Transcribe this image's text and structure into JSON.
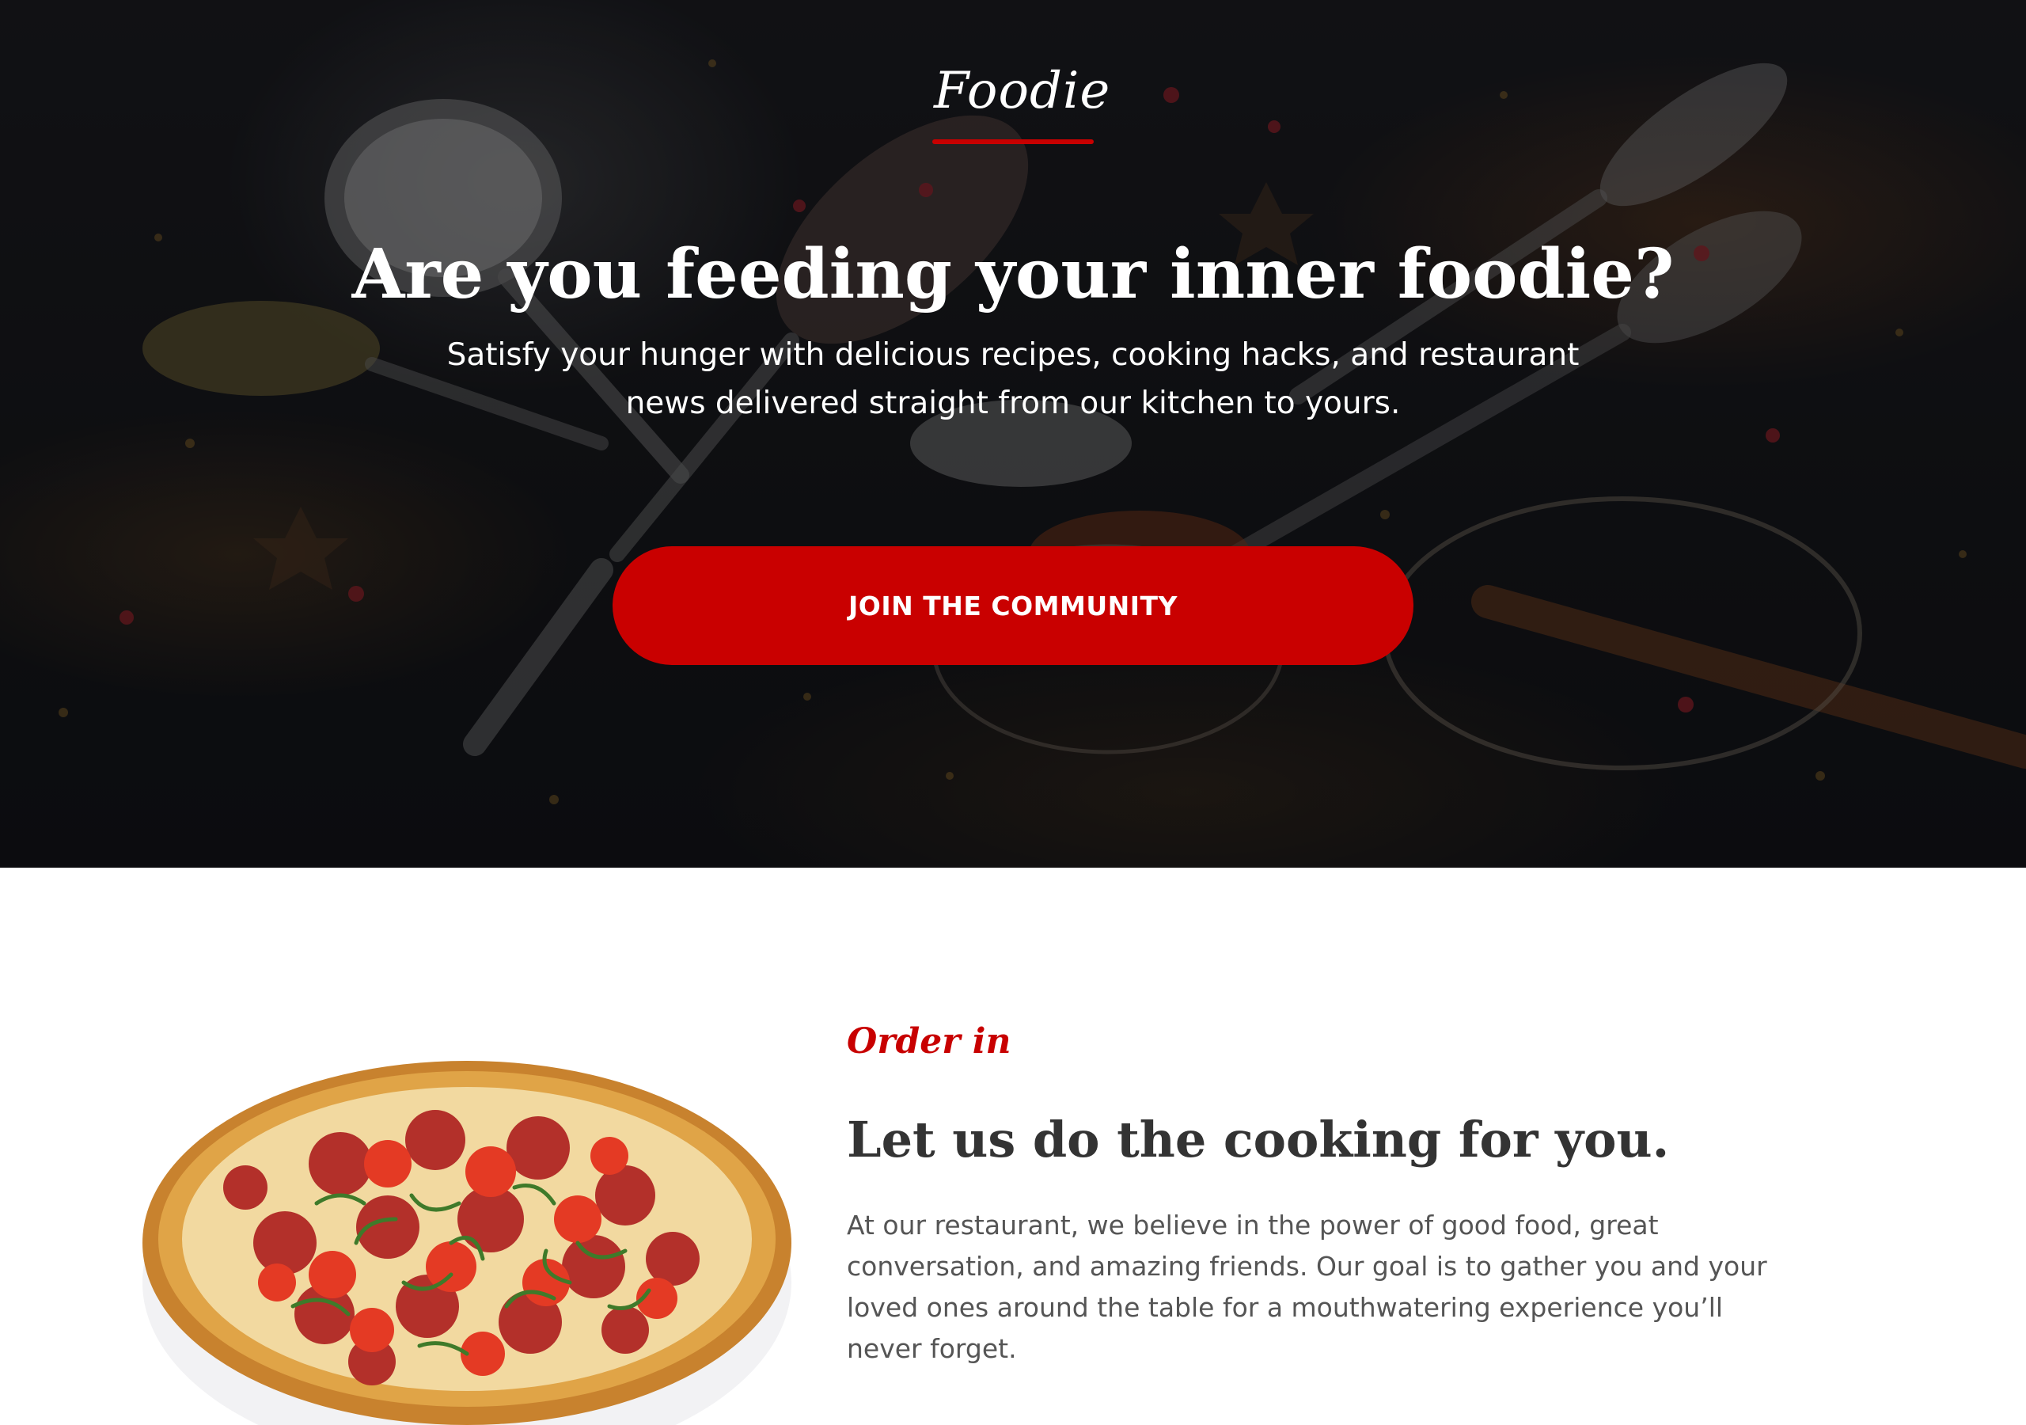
{
  "hero": {
    "logo": "Foodie",
    "title": "Are you feeding your inner foodie?",
    "subtitle": "Satisfy your hunger with delicious recipes, cooking hacks, and restaurant news delivered straight from our kitchen to yours.",
    "cta_label": "JOIN THE COMMUNITY"
  },
  "order_section": {
    "eyebrow": "Order in",
    "title": "Let us do the cooking for you.",
    "body": "At our restaurant, we believe in the power of good food, great conversation, and amazing friends. Our goal is to gather you and your loved ones around the table for a mouthwatering experience you’ll never forget."
  },
  "colors": {
    "accent": "#c80000",
    "hero_bg": "#141518",
    "heading_text": "#333333",
    "body_text": "#555555"
  },
  "images": {
    "hero_background": "spices-and-spoons-image",
    "order_image": "pepperoni-pizza-image"
  }
}
